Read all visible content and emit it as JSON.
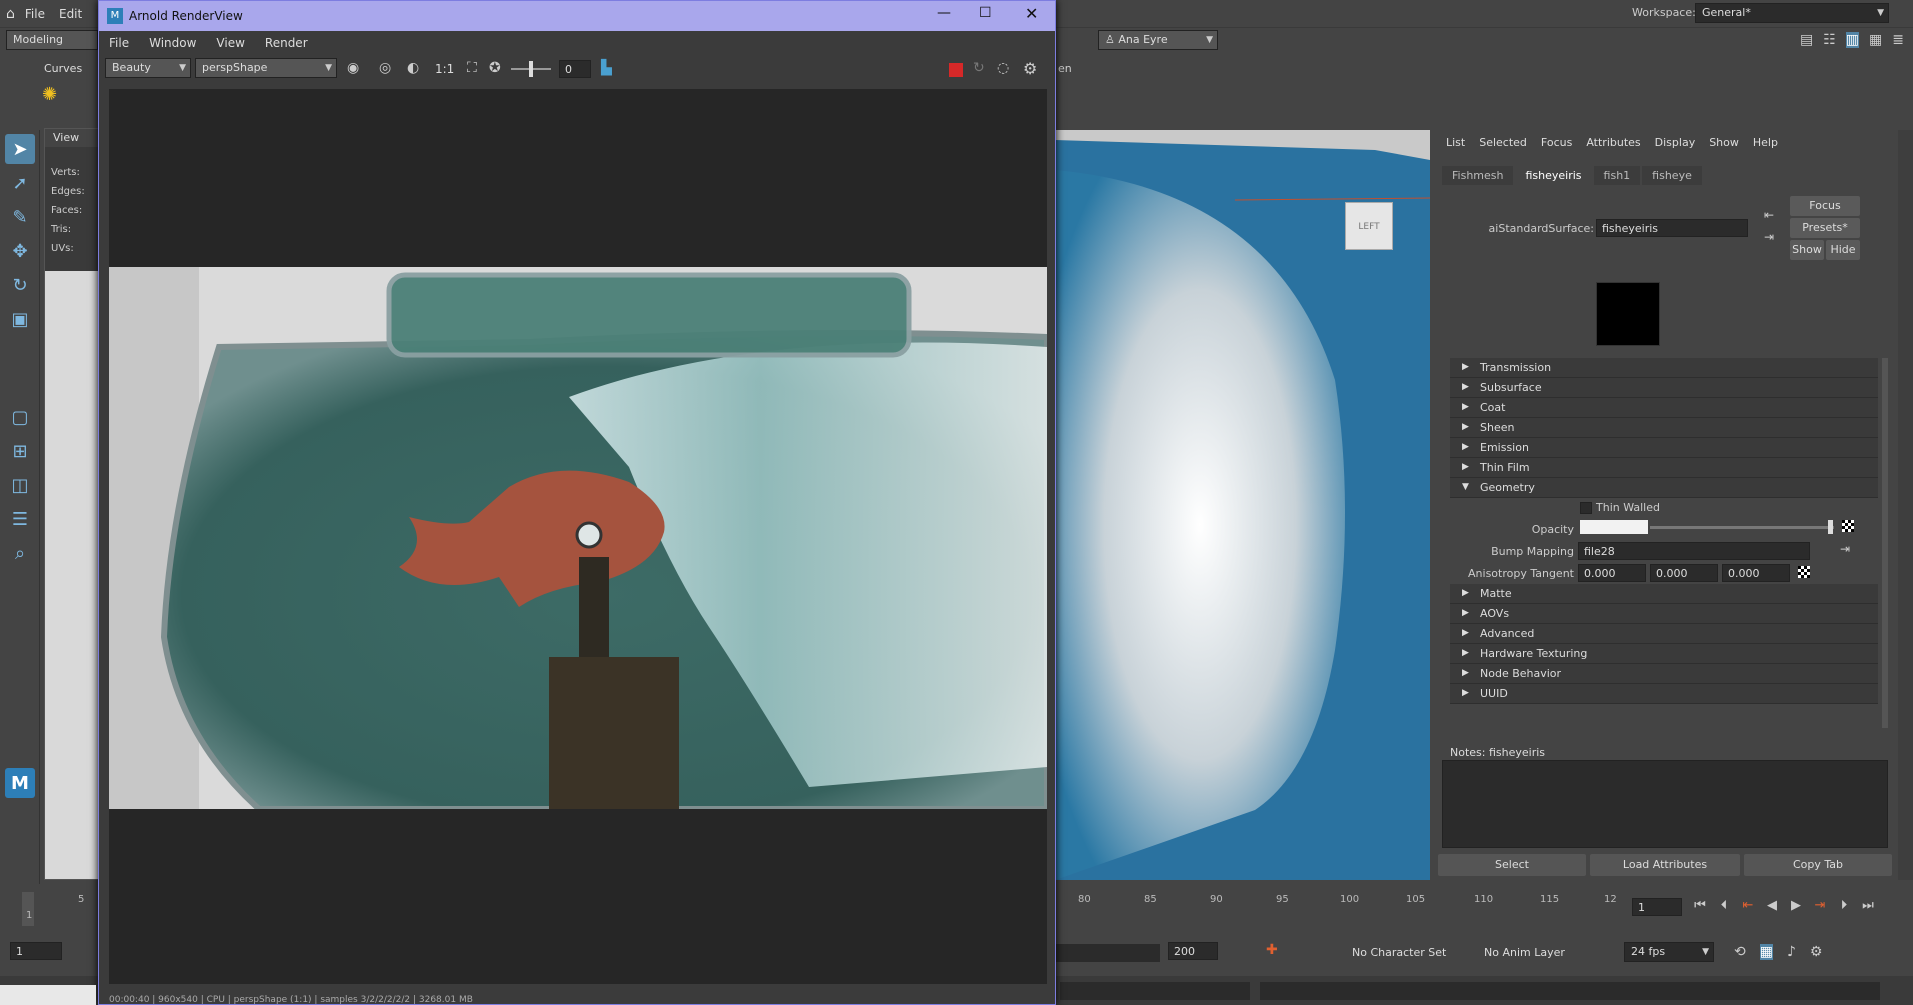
{
  "app": {
    "menu": [
      "File",
      "Edit"
    ],
    "workspace_label": "Workspace:",
    "workspace_value": "General*",
    "mode_value": "Modeling",
    "user": "Ana Eyre",
    "shelf_tab": "Curves",
    "side_label": "en"
  },
  "left_viewport": {
    "menu": "View",
    "stats": [
      "Verts:",
      "Edges:",
      "Faces:",
      "Tris:",
      "UVs:"
    ]
  },
  "right_viewport": {
    "viewcube_label": "LEFT"
  },
  "renderview": {
    "title": "Arnold RenderView",
    "menu": [
      "File",
      "Window",
      "View",
      "Render"
    ],
    "aov": "Beauty",
    "camera": "perspShape",
    "ratio": "1:1",
    "exposure": "0",
    "status": "00:00:40 | 960x540 | CPU | perspShape (1:1) | samples 3/2/2/2/2/2 | 3268.01 MB",
    "colors": {
      "title_bg": "#a9a7ec",
      "stop_button": "#d62828"
    }
  },
  "attribute_editor": {
    "menu": [
      "List",
      "Selected",
      "Focus",
      "Attributes",
      "Display",
      "Show",
      "Help"
    ],
    "tabs": [
      "Fishmesh",
      "fisheyeiris",
      "fish1",
      "fisheye"
    ],
    "active_tab": "fisheyeiris",
    "shader_label": "aiStandardSurface:",
    "shader_value": "fisheyeiris",
    "buttons": {
      "focus": "Focus",
      "presets": "Presets*",
      "show": "Show",
      "hide": "Hide"
    },
    "sections_top": [
      "Transmission",
      "Subsurface",
      "Coat",
      "Sheen",
      "Emission",
      "Thin Film",
      "Geometry"
    ],
    "geometry": {
      "thin_walled": "Thin Walled",
      "opacity_label": "Opacity",
      "opacity_value": 1.0,
      "bump_label": "Bump Mapping",
      "bump_value": "file28",
      "aniso_label": "Anisotropy Tangent",
      "aniso_values": [
        "0.000",
        "0.000",
        "0.000"
      ]
    },
    "sections_bottom": [
      "Matte",
      "AOVs",
      "Advanced",
      "Hardware Texturing",
      "Node Behavior",
      "UUID"
    ],
    "notes_label": "Notes:  fisheyeiris",
    "bottom_buttons": [
      "Select",
      "Load Attributes",
      "Copy Tab"
    ]
  },
  "timeline": {
    "left_ticks": [
      "1",
      "5"
    ],
    "right_ticks": [
      "80",
      "85",
      "90",
      "95",
      "100",
      "105",
      "110",
      "115",
      "12"
    ],
    "current_frame": "1"
  },
  "range": {
    "start": "1",
    "end": "200",
    "character_set": "No Character Set",
    "anim_layer": "No Anim Layer",
    "fps": "24 fps"
  }
}
